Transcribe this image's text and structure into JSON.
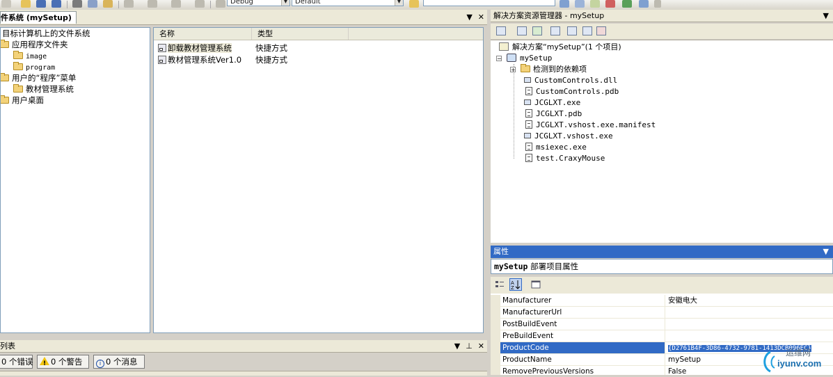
{
  "toolbar": {
    "config_combo": "Debug",
    "platform_combo": "Default"
  },
  "fs_editor": {
    "tab_title": "件系统 (mySetup)",
    "tree": [
      {
        "label": "目标计算机上的文件系统"
      },
      {
        "label": "应用程序文件夹"
      },
      {
        "label": "image"
      },
      {
        "label": "program"
      },
      {
        "label": "用户的“程序”菜单"
      },
      {
        "label": "教材管理系统"
      },
      {
        "label": "用户桌面"
      }
    ],
    "columns": {
      "name": "名称",
      "type": "类型"
    },
    "rows": [
      {
        "name": "卸载教材管理系统",
        "type": "快捷方式"
      },
      {
        "name": "教材管理系统Ver1.0",
        "type": "快捷方式"
      }
    ]
  },
  "error_list": {
    "title": "列表",
    "errors": "0 个错误",
    "warnings": "0 个警告",
    "messages": "0 个消息"
  },
  "solution_explorer": {
    "title": "解决方案资源管理器 - mySetup",
    "solution": "解决方案“mySetup”(1 个项目)",
    "project": "mySetup",
    "items": [
      {
        "label": "检测到的依赖项",
        "icon": "folder"
      },
      {
        "label": "CustomControls.dll",
        "icon": "exe"
      },
      {
        "label": "CustomControls.pdb",
        "icon": "file"
      },
      {
        "label": "JCGLXT.exe",
        "icon": "exe"
      },
      {
        "label": "JCGLXT.pdb",
        "icon": "file"
      },
      {
        "label": "JCGLXT.vshost.exe.manifest",
        "icon": "file"
      },
      {
        "label": "JCGLXT.vshost.exe",
        "icon": "exe"
      },
      {
        "label": "msiexec.exe",
        "icon": "file"
      },
      {
        "label": "test.CraxyMouse",
        "icon": "file"
      }
    ]
  },
  "properties": {
    "title": "属性",
    "object_name": "mySetup",
    "object_desc": "部署项目属性",
    "rows": [
      {
        "name": "Manufacturer",
        "value": "安徽电大"
      },
      {
        "name": "ManufacturerUrl",
        "value": ""
      },
      {
        "name": "PostBuildEvent",
        "value": ""
      },
      {
        "name": "PreBuildEvent",
        "value": ""
      },
      {
        "name": "ProductCode",
        "value": "{D2761B4F-3D86-4732-9781-1413DCB096EC}"
      },
      {
        "name": "ProductName",
        "value": "mySetup"
      },
      {
        "name": "RemovePreviousVersions",
        "value": "False"
      }
    ]
  },
  "watermark": {
    "text": "iyunv.com",
    "text2": "运维网"
  }
}
